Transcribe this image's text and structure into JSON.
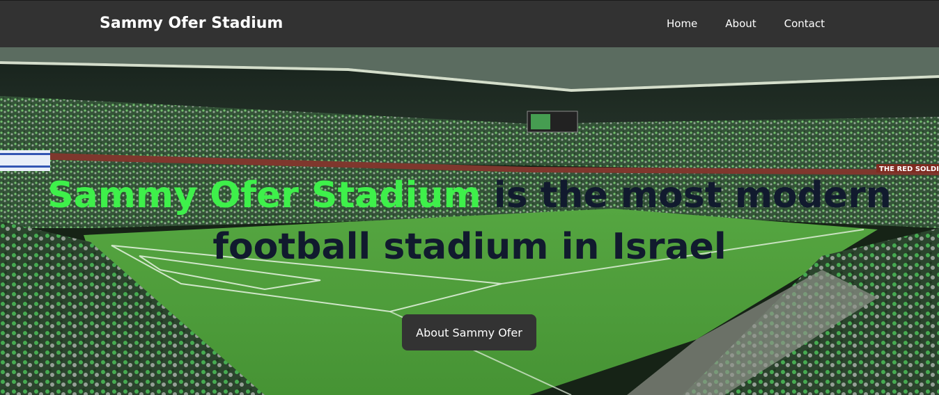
{
  "navbar": {
    "brand": "Sammy Ofer Stadium",
    "links": [
      {
        "label": "Home"
      },
      {
        "label": "About"
      },
      {
        "label": "Contact"
      }
    ],
    "background": "#323232"
  },
  "hero": {
    "headline_accent": "Sammy Ofer Stadium",
    "headline_rest": " is the most modern football stadium in Israel",
    "accent_color": "#3ef04a",
    "headline_color": "#111a2e",
    "cta_label": "About Sammy Ofer",
    "background_image": "stadium-night-photo",
    "banner_text": "THE RED SOLDIE"
  }
}
